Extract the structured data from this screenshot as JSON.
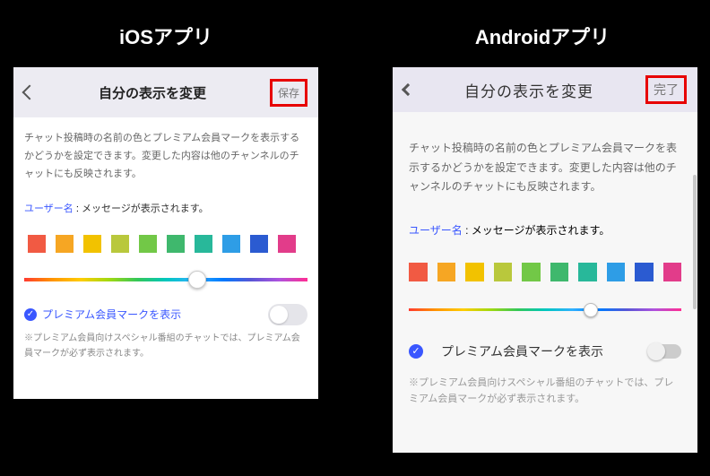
{
  "headings": {
    "ios": "iOSアプリ",
    "android": "Androidアプリ"
  },
  "ios": {
    "title": "自分の表示を変更",
    "save": "保存",
    "description": "チャット投稿時の名前の色とプレミアム会員マークを表示するかどうかを設定できます。変更した内容は他のチャンネルのチャットにも反映されます。",
    "user_label": "ユーザー名",
    "user_sep": " : ",
    "user_msg": "メッセージが表示されます。",
    "swatches": [
      "#f15a43",
      "#f6a623",
      "#f2c200",
      "#b9c83c",
      "#72c847",
      "#3fb86d",
      "#28b89a",
      "#2e9de6",
      "#2b5bd1",
      "#e23c8a"
    ],
    "slider_pos_pct": 58,
    "premium_label": "プレミアム会員マークを表示",
    "premium_checked": true,
    "toggle_on": false,
    "note": "※プレミアム会員向けスペシャル番組のチャットでは、プレミアム会員マークが必ず表示されます。"
  },
  "android": {
    "title": "自分の表示を変更",
    "done": "完了",
    "description": "チャット投稿時の名前の色とプレミアム会員マークを表示するかどうかを設定できます。変更した内容は他のチャンネルのチャットにも反映されます。",
    "user_label": "ユーザー名",
    "user_sep": " : ",
    "user_msg": "メッセージが表示されます。",
    "swatches": [
      "#f15a43",
      "#f6a623",
      "#f2c200",
      "#b9c83c",
      "#72c847",
      "#3fb86d",
      "#28b89a",
      "#2e9de6",
      "#2b5bd1",
      "#e23c8a"
    ],
    "slider_pos_pct": 64,
    "premium_label": "プレミアム会員マークを表示",
    "premium_checked": true,
    "toggle_on": false,
    "note": "※プレミアム会員向けスペシャル番組のチャットでは、プレミアム会員マークが必ず表示されます。"
  }
}
